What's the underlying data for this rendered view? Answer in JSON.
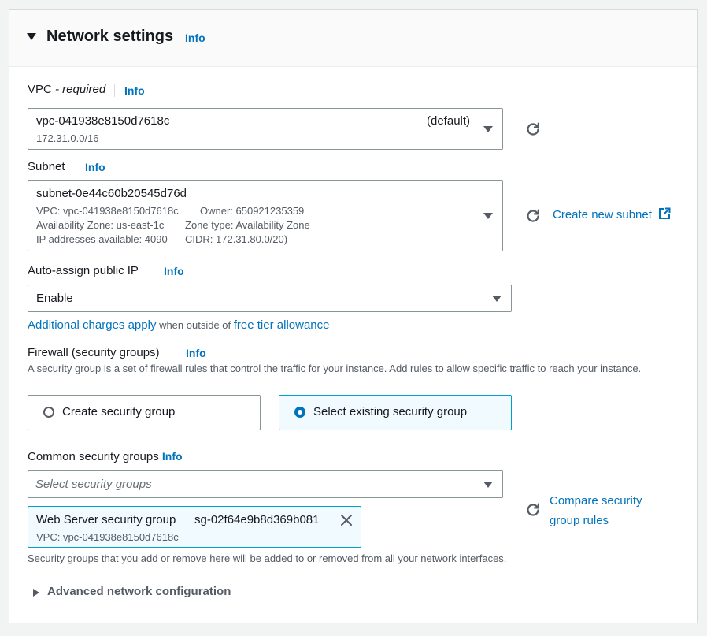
{
  "section": {
    "title": "Network settings",
    "info": "Info"
  },
  "vpc": {
    "label": "VPC",
    "required": " - required",
    "info": "Info",
    "value": "vpc-041938e8150d7618c",
    "tag": "(default)",
    "cidr": "172.31.0.0/16"
  },
  "subnet": {
    "label": "Subnet",
    "info": "Info",
    "value": "subnet-0e44c60b20545d76d",
    "vpc_line": "VPC: vpc-041938e8150d7618c",
    "owner_line": "Owner: 650921235359",
    "az_line": "Availability Zone: us-east-1c",
    "zone_type_line": "Zone type: Availability Zone",
    "ip_line": "IP addresses available: 4090",
    "cidr_line": "CIDR: 172.31.80.0/20)",
    "create_link": "Create new subnet"
  },
  "public_ip": {
    "label": "Auto-assign public IP",
    "info": "Info",
    "value": "Enable",
    "charges_link": "Additional charges apply",
    "charges_middle": " when outside of ",
    "free_tier_link": "free tier allowance"
  },
  "firewall": {
    "label": "Firewall (security groups)",
    "info": "Info",
    "description": "A security group is a set of firewall rules that control the traffic for your instance. Add rules to allow specific traffic to reach your instance.",
    "option_create": "Create security group",
    "option_existing": "Select existing security group",
    "selected": "existing"
  },
  "common_sg": {
    "label": "Common security groups",
    "info": "Info",
    "placeholder": "Select security groups",
    "compare_link_line1": "Compare security",
    "compare_link_line2": "group rules",
    "token_name": "Web Server security group",
    "token_id": "sg-02f64e9b8d369b081",
    "token_vpc": "VPC: vpc-041938e8150d7618c",
    "note": "Security groups that you add or remove here will be added to or removed from all your network interfaces."
  },
  "advanced": {
    "label": "Advanced network configuration"
  },
  "colors": {
    "link": "#0073bb",
    "text": "#16191f",
    "secondary": "#545b64",
    "selected_bg": "#f1faff",
    "border": "#879596"
  },
  "icons": {
    "section_toggle": "caret-down-icon",
    "refresh": "refresh-icon",
    "external": "external-link-icon",
    "dropdown": "triangle-down-icon",
    "remove": "close-icon",
    "advanced_toggle": "caret-right-icon"
  }
}
